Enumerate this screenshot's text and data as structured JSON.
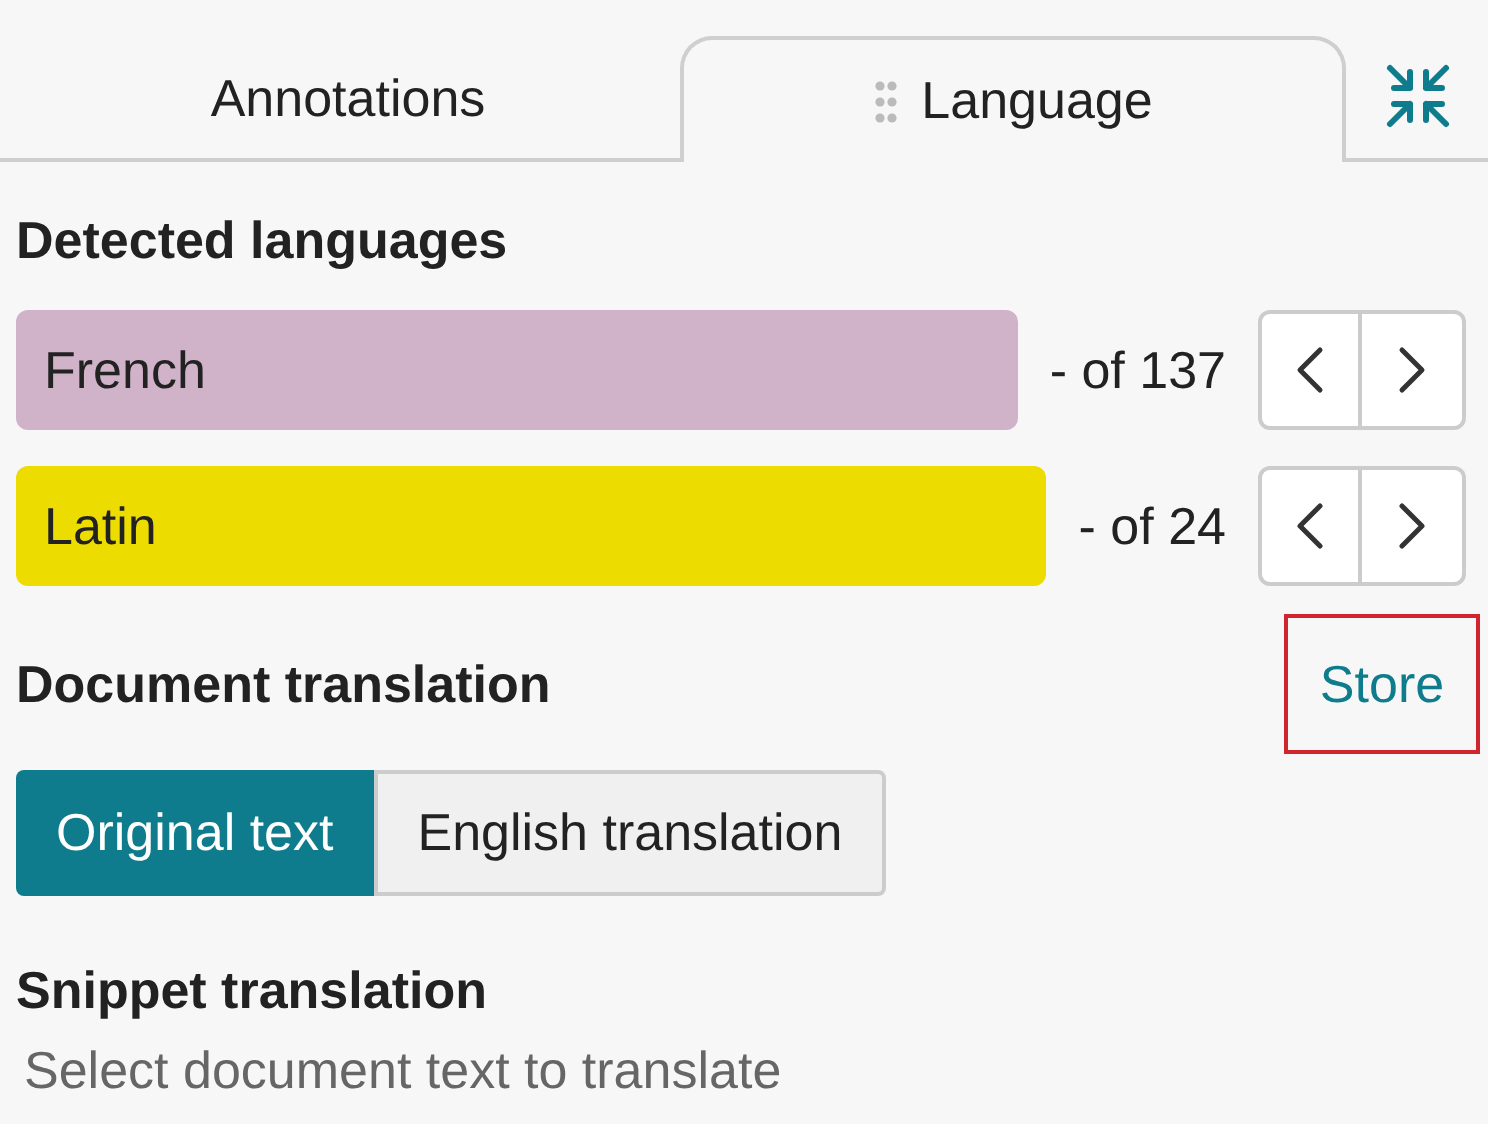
{
  "tabs": [
    {
      "label": "Annotations",
      "selected": false,
      "draggable": false
    },
    {
      "label": "Language",
      "selected": true,
      "draggable": true
    }
  ],
  "detected": {
    "title": "Detected languages",
    "languages": [
      {
        "name": "French",
        "color": "#d1b3c9",
        "count": "- of 137"
      },
      {
        "name": "Latin",
        "color": "#eddc00",
        "count": "- of 24"
      }
    ]
  },
  "document_translation": {
    "title": "Document translation",
    "store_link": {
      "label": "Store",
      "highlighted": true
    },
    "options": [
      {
        "label": "Original text",
        "selected": true
      },
      {
        "label": "English translation",
        "selected": false
      }
    ]
  },
  "snippet_translation": {
    "title": "Snippet translation",
    "hint": "Select document text to translate"
  }
}
